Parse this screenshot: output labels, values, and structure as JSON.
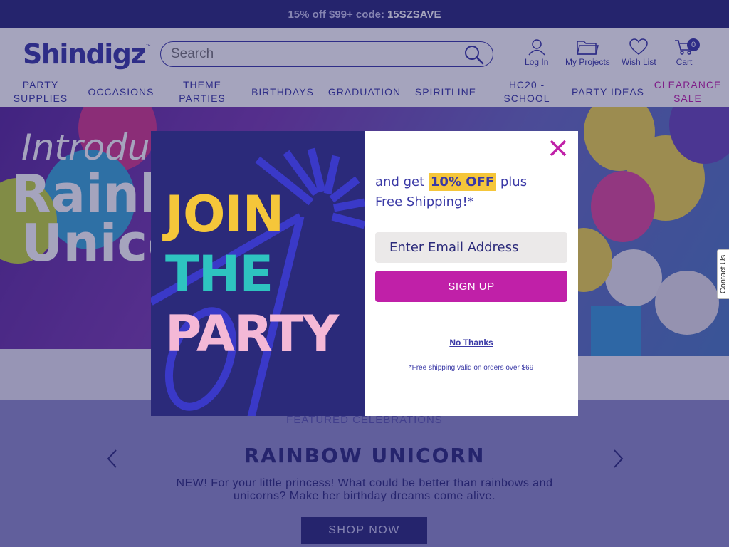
{
  "promo": {
    "text": "15% off $99+ code:",
    "code": "15SZSAVE"
  },
  "header": {
    "logo": "Shindigz",
    "logo_mark": "™",
    "search_placeholder": "Search",
    "login": "Log In",
    "projects": "My Projects",
    "wishlist": "Wish List",
    "cart": "Cart",
    "cart_count": "0"
  },
  "nav": {
    "party_supplies_1": "PARTY",
    "party_supplies_2": "SUPPLIES",
    "occasions": "OCCASIONS",
    "theme_parties_1": "THEME",
    "theme_parties_2": "PARTIES",
    "birthdays": "BIRTHDAYS",
    "graduation": "GRADUATION",
    "spiritline": "SPIRITLINE",
    "hc20_1": "HC20 -",
    "hc20_2": "SCHOOL",
    "party_ideas": "PARTY IDEAS",
    "clearance_1": "CLEARANCE",
    "clearance_2": "SALE"
  },
  "hero": {
    "intro": "Introdu",
    "line2": "Rainb",
    "line3": "Unico"
  },
  "featured": {
    "label": "FEATURED CELEBRATIONS",
    "title": "RAINBOW UNICORN",
    "description": "NEW! For your little princess! What could be better than rainbows and unicorns? Make her birthday dreams come alive.",
    "button": "SHOP NOW"
  },
  "contact_tab": "Contact Us",
  "modal": {
    "word1": "JOIN",
    "word2": "THE",
    "word3": "PARTY",
    "offer_prefix": "and get",
    "offer_highlight": "10% OFF",
    "offer_suffix": "plus",
    "offer_line2": "Free Shipping!*",
    "email_placeholder": "Enter Email Address",
    "signup": "SIGN UP",
    "no_thanks": "No Thanks",
    "disclaimer": "*Free shipping valid on orders over $69"
  },
  "colors": {
    "brand_navy": "#2b2a7a",
    "brand_blue": "#3a39a6",
    "magenta": "#c020a8",
    "yellow": "#f5c63a",
    "teal": "#2ec4c0",
    "pink": "#f4b8d6"
  }
}
